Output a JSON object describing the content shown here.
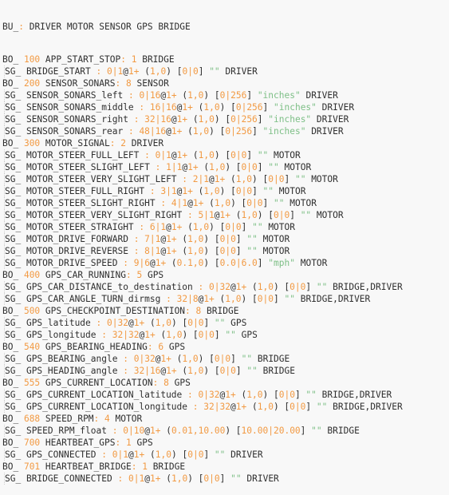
{
  "editor": {
    "language": "dbc",
    "colors": {
      "text": "#2f2f2f",
      "number": "#f29a43",
      "string": "#7dbf86",
      "background": "#f8f8f8"
    },
    "nodes_line": {
      "keyword": "BU_",
      "nodes": [
        "DRIVER",
        "MOTOR",
        "SENSOR",
        "GPS",
        "BRIDGE"
      ]
    },
    "messages": [
      {
        "id": "100",
        "name": "APP_START_STOP",
        "dlc": "1",
        "sender": "BRIDGE",
        "signals": [
          {
            "name": "BRIDGE_START",
            "start": "0",
            "len": "1",
            "order": "1+",
            "factor": "1",
            "offset": "0",
            "min": "0",
            "max": "0",
            "unit": "",
            "receivers": "DRIVER"
          }
        ]
      },
      {
        "id": "200",
        "name": "SENSOR_SONARS",
        "dlc": "8",
        "sender": "SENSOR",
        "signals": [
          {
            "name": "SENSOR_SONARS_left",
            "start": "0",
            "len": "16",
            "order": "1+",
            "factor": "1",
            "offset": "0",
            "min": "0",
            "max": "256",
            "unit": "inches",
            "receivers": "DRIVER"
          },
          {
            "name": "SENSOR_SONARS_middle",
            "start": "16",
            "len": "16",
            "order": "1+",
            "factor": "1",
            "offset": "0",
            "min": "0",
            "max": "256",
            "unit": "inches",
            "receivers": "DRIVER"
          },
          {
            "name": "SENSOR_SONARS_right",
            "start": "32",
            "len": "16",
            "order": "1+",
            "factor": "1",
            "offset": "0",
            "min": "0",
            "max": "256",
            "unit": "inches",
            "receivers": "DRIVER"
          },
          {
            "name": "SENSOR_SONARS_rear",
            "start": "48",
            "len": "16",
            "order": "1+",
            "factor": "1",
            "offset": "0",
            "min": "0",
            "max": "256",
            "unit": "inches",
            "receivers": "DRIVER"
          }
        ]
      },
      {
        "id": "300",
        "name": "MOTOR_SIGNAL",
        "dlc": "2",
        "sender": "DRIVER",
        "signals": [
          {
            "name": "MOTOR_STEER_FULL_LEFT",
            "start": "0",
            "len": "1",
            "order": "1+",
            "factor": "1",
            "offset": "0",
            "min": "0",
            "max": "0",
            "unit": "",
            "receivers": "MOTOR"
          },
          {
            "name": "MOTOR_STEER_SLIGHT_LEFT",
            "start": "1",
            "len": "1",
            "order": "1+",
            "factor": "1",
            "offset": "0",
            "min": "0",
            "max": "0",
            "unit": "",
            "receivers": "MOTOR"
          },
          {
            "name": "MOTOR_STEER_VERY_SLIGHT_LEFT",
            "start": "2",
            "len": "1",
            "order": "1+",
            "factor": "1",
            "offset": "0",
            "min": "0",
            "max": "0",
            "unit": "",
            "receivers": "MOTOR"
          },
          {
            "name": "MOTOR_STEER_FULL_RIGHT",
            "start": "3",
            "len": "1",
            "order": "1+",
            "factor": "1",
            "offset": "0",
            "min": "0",
            "max": "0",
            "unit": "",
            "receivers": "MOTOR"
          },
          {
            "name": "MOTOR_STEER_SLIGHT_RIGHT",
            "start": "4",
            "len": "1",
            "order": "1+",
            "factor": "1",
            "offset": "0",
            "min": "0",
            "max": "0",
            "unit": "",
            "receivers": "MOTOR"
          },
          {
            "name": "MOTOR_STEER_VERY_SLIGHT_RIGHT",
            "start": "5",
            "len": "1",
            "order": "1+",
            "factor": "1",
            "offset": "0",
            "min": "0",
            "max": "0",
            "unit": "",
            "receivers": "MOTOR"
          },
          {
            "name": "MOTOR_STEER_STRAIGHT",
            "start": "6",
            "len": "1",
            "order": "1+",
            "factor": "1",
            "offset": "0",
            "min": "0",
            "max": "0",
            "unit": "",
            "receivers": "MOTOR"
          },
          {
            "name": "MOTOR_DRIVE_FORWARD",
            "start": "7",
            "len": "1",
            "order": "1+",
            "factor": "1",
            "offset": "0",
            "min": "0",
            "max": "0",
            "unit": "",
            "receivers": "MOTOR"
          },
          {
            "name": "MOTOR_DRIVE_REVERSE",
            "start": "8",
            "len": "1",
            "order": "1+",
            "factor": "1",
            "offset": "0",
            "min": "0",
            "max": "0",
            "unit": "",
            "receivers": "MOTOR"
          },
          {
            "name": "MOTOR_DRIVE_SPEED",
            "start": "9",
            "len": "6",
            "order": "1+",
            "factor": "0.1",
            "offset": "0",
            "min": "0.0",
            "max": "6.0",
            "unit": "mph",
            "receivers": "MOTOR"
          }
        ]
      },
      {
        "id": "400",
        "name": "GPS_CAR_RUNNING",
        "dlc": "5",
        "sender": "GPS",
        "signals": [
          {
            "name": "GPS_CAR_DISTANCE_to_destination",
            "start": "0",
            "len": "32",
            "order": "1+",
            "factor": "1",
            "offset": "0",
            "min": "0",
            "max": "0",
            "unit": "",
            "receivers": "BRIDGE,DRIVER"
          },
          {
            "name": "GPS_CAR_ANGLE_TURN_dirmsg",
            "start": "32",
            "len": "8",
            "order": "1+",
            "factor": "1",
            "offset": "0",
            "min": "0",
            "max": "0",
            "unit": "",
            "receivers": "BRIDGE,DRIVER"
          }
        ]
      },
      {
        "id": "500",
        "name": "GPS_CHECKPOINT_DESTINATION",
        "dlc": "8",
        "sender": "BRIDGE",
        "signals": [
          {
            "name": "GPS_latitude",
            "start": "0",
            "len": "32",
            "order": "1+",
            "factor": "1",
            "offset": "0",
            "min": "0",
            "max": "0",
            "unit": "",
            "receivers": "GPS"
          },
          {
            "name": "GPS_longitude",
            "start": "32",
            "len": "32",
            "order": "1+",
            "factor": "1",
            "offset": "0",
            "min": "0",
            "max": "0",
            "unit": "",
            "receivers": "GPS"
          }
        ]
      },
      {
        "id": "540",
        "name": "GPS_BEARING_HEADING",
        "dlc": "6",
        "sender": "GPS",
        "signals": [
          {
            "name": "GPS_BEARING_angle",
            "start": "0",
            "len": "32",
            "order": "1+",
            "factor": "1",
            "offset": "0",
            "min": "0",
            "max": "0",
            "unit": "",
            "receivers": "BRIDGE"
          },
          {
            "name": "GPS_HEADING_angle",
            "start": "32",
            "len": "16",
            "order": "1+",
            "factor": "1",
            "offset": "0",
            "min": "0",
            "max": "0",
            "unit": "",
            "receivers": "BRIDGE"
          }
        ]
      },
      {
        "id": "555",
        "name": "GPS_CURRENT_LOCATION",
        "dlc": "8",
        "sender": "GPS",
        "signals": [
          {
            "name": "GPS_CURRENT_LOCATION_latitude",
            "start": "0",
            "len": "32",
            "order": "1+",
            "factor": "1",
            "offset": "0",
            "min": "0",
            "max": "0",
            "unit": "",
            "receivers": "BRIDGE,DRIVER"
          },
          {
            "name": "GPS_CURRENT_LOCATION_longitude",
            "start": "32",
            "len": "32",
            "order": "1+",
            "factor": "1",
            "offset": "0",
            "min": "0",
            "max": "0",
            "unit": "",
            "receivers": "BRIDGE,DRIVER"
          }
        ]
      },
      {
        "id": "688",
        "name": "SPEED_RPM",
        "dlc": "4",
        "sender": "MOTOR",
        "signals": [
          {
            "name": "SPEED_RPM_float",
            "start": "0",
            "len": "10",
            "order": "1+",
            "factor": "0.01",
            "offset": "10.00",
            "min": "10.00",
            "max": "20.00",
            "unit": "",
            "receivers": "BRIDGE"
          }
        ]
      },
      {
        "id": "700",
        "name": "HEARTBEAT_GPS",
        "dlc": "1",
        "sender": "GPS",
        "signals": [
          {
            "name": "GPS_CONNECTED",
            "start": "0",
            "len": "1",
            "order": "1+",
            "factor": "1",
            "offset": "0",
            "min": "0",
            "max": "0",
            "unit": "",
            "receivers": "DRIVER"
          }
        ]
      },
      {
        "id": "701",
        "name": "HEARTBEAT_BRIDGE",
        "dlc": "1",
        "sender": "BRIDGE",
        "signals": [
          {
            "name": "BRIDGE_CONNECTED",
            "start": "0",
            "len": "1",
            "order": "1+",
            "factor": "1",
            "offset": "0",
            "min": "0",
            "max": "0",
            "unit": "",
            "receivers": "DRIVER"
          }
        ]
      }
    ]
  }
}
